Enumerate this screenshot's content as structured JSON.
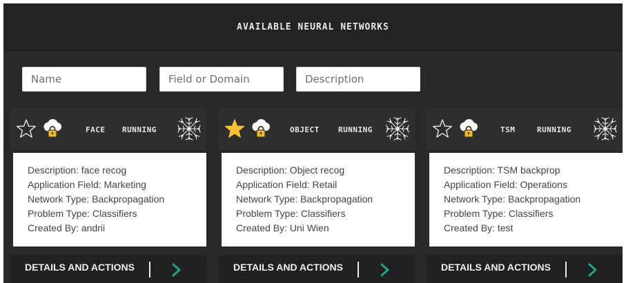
{
  "header": {
    "title": "AVAILABLE NEURAL NETWORKS"
  },
  "filters": {
    "name_placeholder": "Name",
    "field_placeholder": "Field or Domain",
    "description_placeholder": "Description"
  },
  "colors": {
    "star_active": "#f6c233",
    "chevron": "#21a58a",
    "lock": "#f0b72f",
    "background": "#2a2929"
  },
  "icons": {
    "favorite": "star-icon",
    "access": "cloud-lock-icon",
    "network": "neural-network-icon",
    "action": "chevron-right-icon"
  },
  "cards": [
    {
      "name": "FACE",
      "status": "RUNNING",
      "favorite": false,
      "description": "Description: face recog",
      "application_field": "Application Field: Marketing",
      "network_type": "Network Type: Backpropagation",
      "problem_type": "Problem Type: Classifiers",
      "created_by": "Created By: andrii",
      "action_label": "DETAILS AND ACTIONS"
    },
    {
      "name": "OBJECT",
      "status": "RUNNING",
      "favorite": true,
      "description": "Description: Object recog",
      "application_field": "Application Field: Retail",
      "network_type": "Network Type: Backpropagation",
      "problem_type": "Problem Type: Classifiers",
      "created_by": "Created By: Uni Wien",
      "action_label": "DETAILS AND ACTIONS"
    },
    {
      "name": "TSM",
      "status": "RUNNING",
      "favorite": false,
      "description": "Description: TSM backprop",
      "application_field": "Application Field: Operations",
      "network_type": "Network Type: Backpropagation",
      "problem_type": "Problem Type: Classifiers",
      "created_by": "Created By: test",
      "action_label": "DETAILS AND ACTIONS"
    }
  ]
}
